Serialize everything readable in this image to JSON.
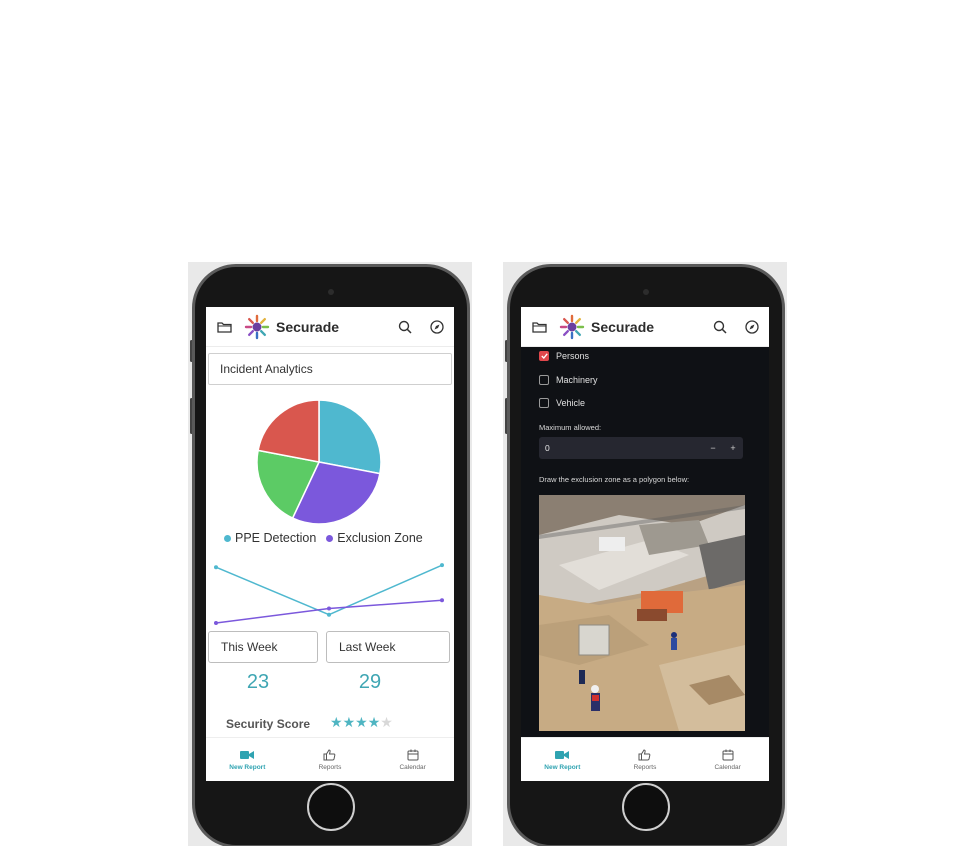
{
  "brand": {
    "name": "Securade"
  },
  "left_screen": {
    "section_title": "Incident Analytics",
    "legend": [
      {
        "label": "PPE Detection",
        "color": "#4fb8cf"
      },
      {
        "label": "Exclusion Zone",
        "color": "#7b58dc"
      }
    ],
    "weeks": {
      "this_week_label": "This Week",
      "last_week_label": "Last Week",
      "this_week_value": "23",
      "last_week_value": "29"
    },
    "security_score": {
      "label": "Security Score",
      "stars": 4,
      "max_stars": 5
    }
  },
  "right_screen": {
    "checkboxes": [
      {
        "label": "Persons",
        "checked": true
      },
      {
        "label": "Machinery",
        "checked": false
      },
      {
        "label": "Vehicle",
        "checked": false
      }
    ],
    "max_label": "Maximum allowed:",
    "max_value": "0",
    "minus": "−",
    "plus": "+",
    "draw_label": "Draw the exclusion zone as a polygon below:"
  },
  "nav": [
    {
      "label": "New Report",
      "icon": "video-camera-icon",
      "active": true
    },
    {
      "label": "Reports",
      "icon": "thumbs-up-icon",
      "active": false
    },
    {
      "label": "Calendar",
      "icon": "calendar-icon",
      "active": false
    }
  ],
  "colors": {
    "accent": "#2fa3b1",
    "checkbox": "#e0474c",
    "dark_panel": "#0f1115"
  },
  "chart_data": [
    {
      "type": "pie",
      "categories": [
        "Teal",
        "Purple",
        "Green",
        "Red"
      ],
      "values": [
        28,
        29,
        21,
        22
      ],
      "colors": [
        "#4fb8cf",
        "#7b58dc",
        "#5ccb65",
        "#d9574e"
      ]
    },
    {
      "type": "line",
      "x": [
        0,
        1,
        2
      ],
      "series": [
        {
          "values": [
            2.7,
            0.4,
            2.8
          ],
          "color": "#4fb8cf"
        },
        {
          "values": [
            0.0,
            0.7,
            1.1
          ],
          "color": "#7b58dc"
        }
      ],
      "ylim": [
        0,
        3
      ]
    }
  ]
}
